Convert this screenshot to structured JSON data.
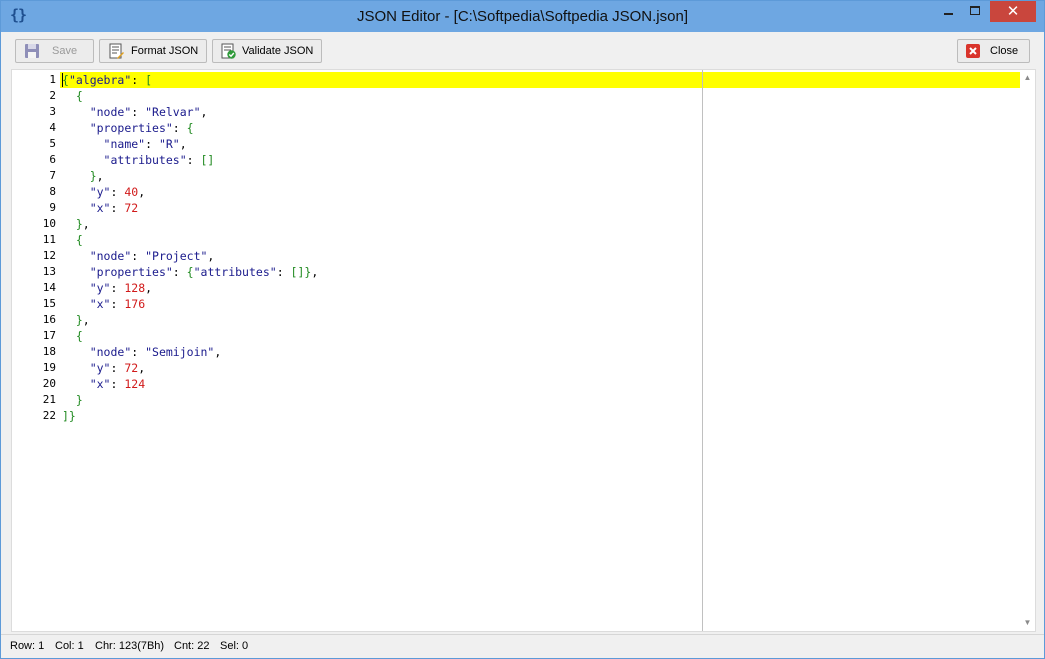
{
  "window": {
    "title": "JSON Editor - [C:\\Softpedia\\Softpedia JSON.json]",
    "app_icon": "{}"
  },
  "toolbar": {
    "save_label": "Save",
    "format_label": "Format JSON",
    "validate_label": "Validate JSON",
    "close_label": "Close"
  },
  "editor": {
    "line_numbers": [
      "1",
      "2",
      "3",
      "4",
      "5",
      "6",
      "7",
      "8",
      "9",
      "10",
      "11",
      "12",
      "13",
      "14",
      "15",
      "16",
      "17",
      "18",
      "19",
      "20",
      "21",
      "22"
    ],
    "lines": [
      [
        [
          "p",
          "{"
        ],
        [
          "k",
          "\"algebra\""
        ],
        [
          "o",
          ": "
        ],
        [
          "p",
          "["
        ]
      ],
      [
        [
          "o",
          "  "
        ],
        [
          "p",
          "{"
        ]
      ],
      [
        [
          "o",
          "    "
        ],
        [
          "k",
          "\"node\""
        ],
        [
          "o",
          ": "
        ],
        [
          "s",
          "\"Relvar\""
        ],
        [
          "o",
          ","
        ]
      ],
      [
        [
          "o",
          "    "
        ],
        [
          "k",
          "\"properties\""
        ],
        [
          "o",
          ": "
        ],
        [
          "p",
          "{"
        ]
      ],
      [
        [
          "o",
          "      "
        ],
        [
          "k",
          "\"name\""
        ],
        [
          "o",
          ": "
        ],
        [
          "s",
          "\"R\""
        ],
        [
          "o",
          ","
        ]
      ],
      [
        [
          "o",
          "      "
        ],
        [
          "k",
          "\"attributes\""
        ],
        [
          "o",
          ": "
        ],
        [
          "p",
          "[]"
        ]
      ],
      [
        [
          "o",
          "    "
        ],
        [
          "p",
          "}"
        ],
        [
          "o",
          ","
        ]
      ],
      [
        [
          "o",
          "    "
        ],
        [
          "k",
          "\"y\""
        ],
        [
          "o",
          ": "
        ],
        [
          "n",
          "40"
        ],
        [
          "o",
          ","
        ]
      ],
      [
        [
          "o",
          "    "
        ],
        [
          "k",
          "\"x\""
        ],
        [
          "o",
          ": "
        ],
        [
          "n",
          "72"
        ]
      ],
      [
        [
          "o",
          "  "
        ],
        [
          "p",
          "}"
        ],
        [
          "o",
          ","
        ]
      ],
      [
        [
          "o",
          "  "
        ],
        [
          "p",
          "{"
        ]
      ],
      [
        [
          "o",
          "    "
        ],
        [
          "k",
          "\"node\""
        ],
        [
          "o",
          ": "
        ],
        [
          "s",
          "\"Project\""
        ],
        [
          "o",
          ","
        ]
      ],
      [
        [
          "o",
          "    "
        ],
        [
          "k",
          "\"properties\""
        ],
        [
          "o",
          ": "
        ],
        [
          "p",
          "{"
        ],
        [
          "k",
          "\"attributes\""
        ],
        [
          "o",
          ": "
        ],
        [
          "p",
          "[]"
        ],
        [
          "p",
          "}"
        ],
        [
          "o",
          ","
        ]
      ],
      [
        [
          "o",
          "    "
        ],
        [
          "k",
          "\"y\""
        ],
        [
          "o",
          ": "
        ],
        [
          "n",
          "128"
        ],
        [
          "o",
          ","
        ]
      ],
      [
        [
          "o",
          "    "
        ],
        [
          "k",
          "\"x\""
        ],
        [
          "o",
          ": "
        ],
        [
          "n",
          "176"
        ]
      ],
      [
        [
          "o",
          "  "
        ],
        [
          "p",
          "}"
        ],
        [
          "o",
          ","
        ]
      ],
      [
        [
          "o",
          "  "
        ],
        [
          "p",
          "{"
        ]
      ],
      [
        [
          "o",
          "    "
        ],
        [
          "k",
          "\"node\""
        ],
        [
          "o",
          ": "
        ],
        [
          "s",
          "\"Semijoin\""
        ],
        [
          "o",
          ","
        ]
      ],
      [
        [
          "o",
          "    "
        ],
        [
          "k",
          "\"y\""
        ],
        [
          "o",
          ": "
        ],
        [
          "n",
          "72"
        ],
        [
          "o",
          ","
        ]
      ],
      [
        [
          "o",
          "    "
        ],
        [
          "k",
          "\"x\""
        ],
        [
          "o",
          ": "
        ],
        [
          "n",
          "124"
        ]
      ],
      [
        [
          "o",
          "  "
        ],
        [
          "p",
          "}"
        ]
      ],
      [
        [
          "p",
          "]}"
        ]
      ]
    ]
  },
  "statusbar": {
    "row": "Row: 1",
    "col": "Col: 1",
    "chr": "Chr: 123(7Bh)",
    "cnt": "Cnt: 22",
    "sel": "Sel: 0"
  },
  "colors": {
    "titlebar": "#6ea7e2",
    "current_line": "#ffff00",
    "key": "#1a1a8c",
    "number": "#d11a1a",
    "punct": "#208a20",
    "close_button": "#c9463d"
  }
}
